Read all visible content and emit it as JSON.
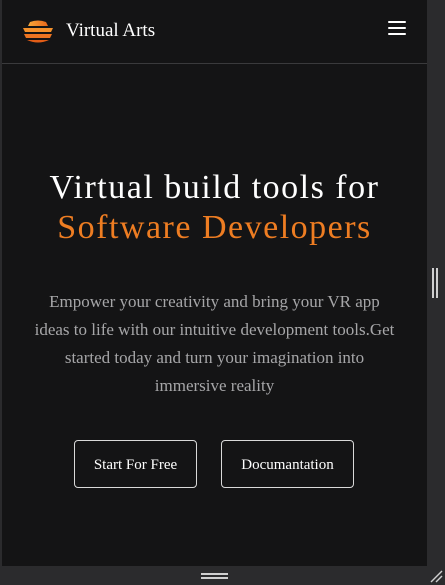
{
  "navbar": {
    "brand": "Virtual Arts",
    "logo_icon": "stacked-layers-logo-icon",
    "menu_icon": "hamburger-menu-icon"
  },
  "hero": {
    "title_line1": "Virtual build tools for",
    "title_line2": "Software Developers",
    "description": "Empower your creativity and bring your VR app ideas to life with our intuitive development tools.Get started today and turn your imagination into immersive reality",
    "primary_button": "Start For Free",
    "secondary_button": "Documantation"
  },
  "colors": {
    "background": "#141415",
    "accent": "#ee7d22",
    "text": "#ffffff",
    "muted_text": "#a6a6a8"
  }
}
